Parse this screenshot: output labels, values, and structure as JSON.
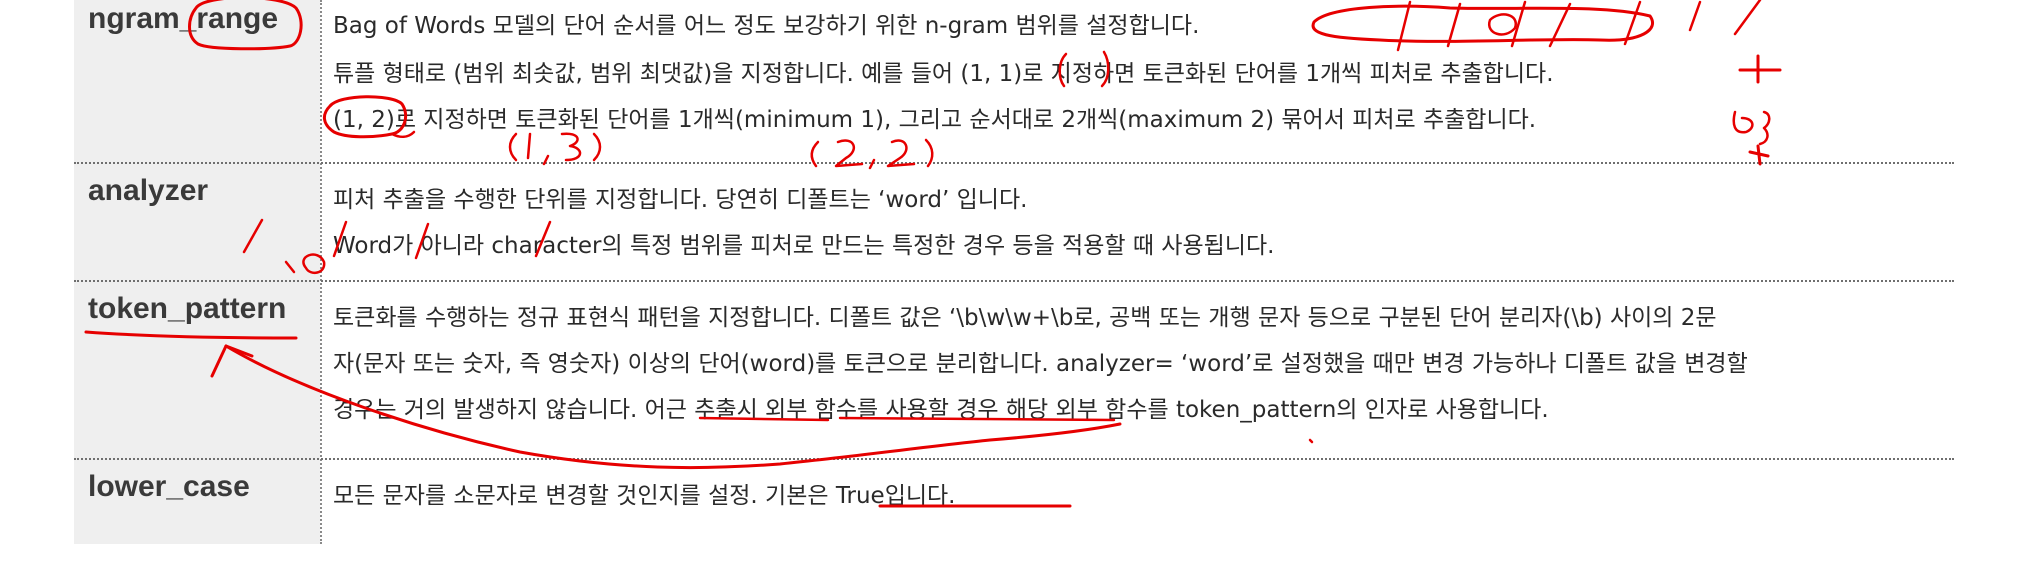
{
  "colors": {
    "param_cell_bg": "#efefef",
    "text": "#2a2a2a",
    "annotation": "#e60000",
    "rule": "#6f6f6f"
  },
  "rows": [
    {
      "param": "ngram_range",
      "lines": [
        "Bag of Words 모델의 단어 순서를 어느 정도 보강하기 위한 n-gram 범위를 설정합니다.",
        "튜플 형태로 (범위 최솟값, 범위 최댓값)을 지정합니다. 예를 들어 (1, 1)로 지정하면 토큰화된 단어를 1개씩 피처로 추출합니다.",
        "(1, 2)로 지정하면 토큰화된 단어를 1개씩(minimum 1), 그리고 순서대로 2개씩(maximum 2) 묶어서 피처로 추출합니다."
      ]
    },
    {
      "param": "analyzer",
      "lines": [
        "피처 추출을 수행한 단위를 지정합니다. 당연히 디폴트는 ‘word’ 입니다.",
        "Word가 아니라 character의 특정 범위를 피처로 만드는 특정한 경우 등을 적용할 때 사용됩니다."
      ]
    },
    {
      "param": "token_pattern",
      "lines": [
        "토큰화를 수행하는 정규 표현식 패턴을 지정합니다. 디폴트 값은 ‘\\b\\w\\w+\\b로, 공백 또는 개행 문자 등으로 구분된 단어 분리자(\\b) 사이의 2문",
        "자(문자 또는 숫자, 즉 영숫자) 이상의 단어(word)를 토큰으로 분리합니다. analyzer= ‘word’로 설정했을 때만 변경 가능하나 디폴트 값을 변경할",
        "경우는 거의 발생하지 않습니다. 어근 추출시 외부 함수를 사용할 경우 해당 외부 함수를 token_pattern의 인자로 사용합니다."
      ]
    },
    {
      "param": "lower_case",
      "lines": [
        "모든 문자를 소문자로 변경할 것인지를 설정. 기본은 True입니다."
      ]
    }
  ],
  "handwritten": {
    "range_13": "(1, 3)",
    "range_22": "(2, 2)"
  }
}
